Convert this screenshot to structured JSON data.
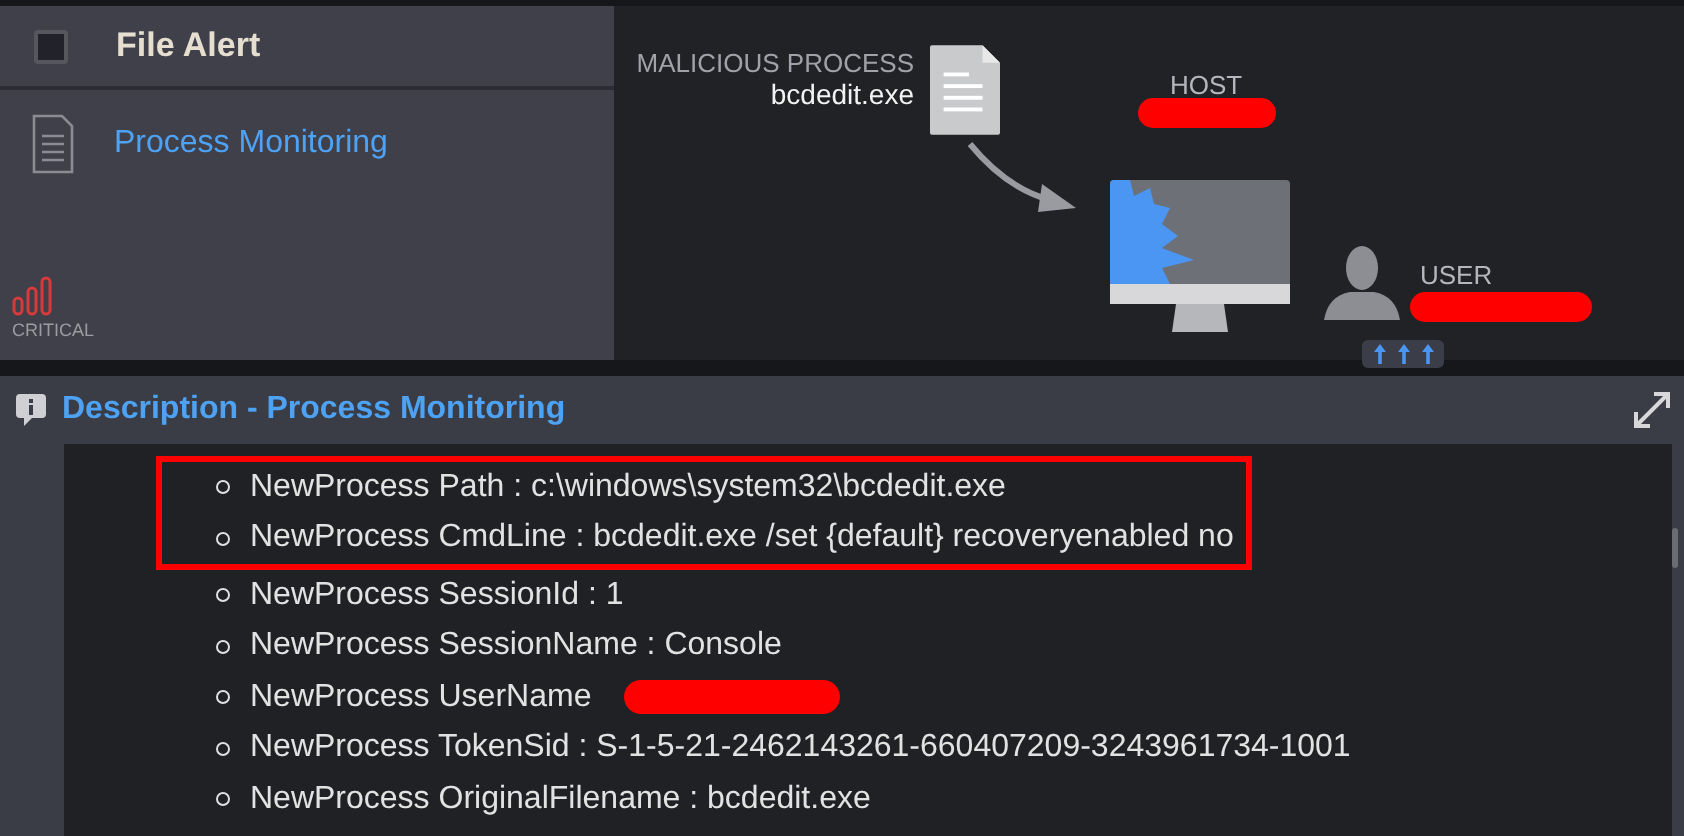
{
  "alert": {
    "checked": false,
    "title": "File Alert",
    "item": "Process Monitoring",
    "severity": "CRITICAL"
  },
  "diagram": {
    "process_label": "MALICIOUS PROCESS",
    "process_name": "bcdedit.exe",
    "host_label": "HOST",
    "host_redacted": true,
    "user_label": "USER",
    "user_redacted": true
  },
  "description": {
    "title": "Description - Process Monitoring",
    "highlighted_items": [
      {
        "kind": "plain",
        "text": "NewProcess Path : c:\\windows\\system32\\bcdedit.exe"
      },
      {
        "kind": "plain",
        "text": "NewProcess CmdLine : bcdedit.exe /set {default} recoveryenabled no"
      }
    ],
    "items": [
      {
        "kind": "plain",
        "text": "NewProcess SessionId : 1"
      },
      {
        "kind": "plain",
        "text": "NewProcess SessionName : Console"
      },
      {
        "kind": "redacted",
        "text": "NewProcess UserName"
      },
      {
        "kind": "plain",
        "text": "NewProcess TokenSid : S-1-5-21-2462143261-660407209-3243961734-1001"
      },
      {
        "kind": "plain",
        "text": "NewProcess OriginalFilename : bcdedit.exe"
      }
    ]
  }
}
